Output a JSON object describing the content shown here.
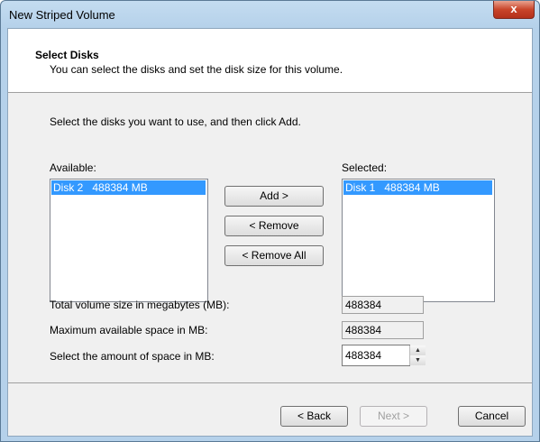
{
  "window": {
    "title": "New Striped Volume",
    "close_label": "x"
  },
  "header": {
    "title": "Select Disks",
    "subtitle": "You can select the disks and set the disk size for this volume."
  },
  "instruction": "Select the disks you want to use, and then click Add.",
  "available": {
    "label": "Available:",
    "items": [
      {
        "disk": "Disk 2",
        "size": "488384 MB",
        "selected": true
      }
    ]
  },
  "selected": {
    "label": "Selected:",
    "items": [
      {
        "disk": "Disk 1",
        "size": "488384 MB",
        "selected": true
      }
    ]
  },
  "buttons": {
    "add": "Add >",
    "remove": "< Remove",
    "remove_all": "< Remove All",
    "back": "< Back",
    "next": "Next >",
    "cancel": "Cancel"
  },
  "fields": {
    "total_label": "Total volume size in megabytes (MB):",
    "total_value": "488384",
    "max_label": "Maximum available space in MB:",
    "max_value": "488384",
    "amount_label": "Select the amount of space in MB:",
    "amount_value": "488384"
  },
  "colors": {
    "selection": "#3399ff",
    "title_bar": "#b5d1ea",
    "close_button": "#c9452a"
  }
}
